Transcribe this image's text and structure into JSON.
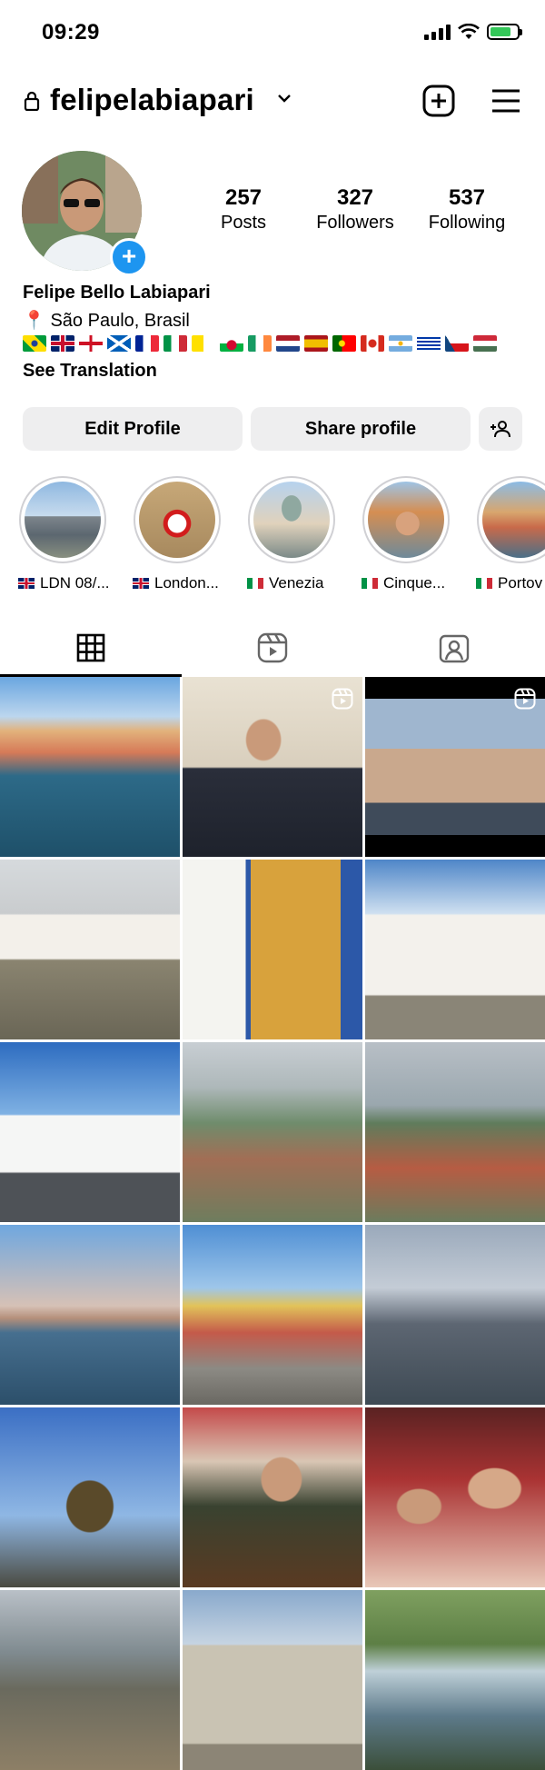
{
  "status_bar": {
    "time": "09:29",
    "battery_level": 0.8,
    "battery_color": "#34c759"
  },
  "header": {
    "username": "felipelabiapari",
    "icons": [
      "lock-icon",
      "chevron-down-icon",
      "new-post-icon",
      "menu-icon"
    ]
  },
  "profile": {
    "stats": [
      {
        "value": "257",
        "label": "Posts"
      },
      {
        "value": "327",
        "label": "Followers"
      },
      {
        "value": "537",
        "label": "Following"
      }
    ],
    "full_name": "Felipe Bello Labiapari",
    "location": "📍 São Paulo, Brasil",
    "flags": [
      "Brazil",
      "United Kingdom",
      "England",
      "Scotland",
      "France",
      "Italy",
      "Vatican City",
      "Wales",
      "Ireland",
      "Netherlands",
      "Spain",
      "Portugal",
      "Canada",
      "Argentina",
      "Uruguay",
      "Czech Republic",
      "Hungary"
    ],
    "see_translation": "See Translation",
    "accent_color": "#1d95f0"
  },
  "actions": {
    "edit_profile": "Edit Profile",
    "share_profile": "Share profile"
  },
  "highlights": [
    {
      "label": "LDN 08/...",
      "flag": "United Kingdom"
    },
    {
      "label": "London...",
      "flag": "United Kingdom"
    },
    {
      "label": "Venezia",
      "flag": "Italy"
    },
    {
      "label": "Cinque...",
      "flag": "Italy"
    },
    {
      "label": "Portov",
      "flag": "Italy"
    }
  ],
  "tabs": [
    {
      "name": "grid-icon",
      "active": true
    },
    {
      "name": "reels-icon",
      "active": false
    },
    {
      "name": "tagged-icon",
      "active": false
    }
  ],
  "posts": [
    {
      "subject": "harbor with colorful houses",
      "reel": false
    },
    {
      "subject": "man playing electric guitar",
      "reel": true
    },
    {
      "subject": "man playing guitar",
      "reel": true
    },
    {
      "subject": "cobblestone colonial street",
      "reel": false
    },
    {
      "subject": "man sitting on steps",
      "reel": false
    },
    {
      "subject": "colonial building with lamp",
      "reel": false
    },
    {
      "subject": "baroque church",
      "reel": false
    },
    {
      "subject": "hillside town view",
      "reel": false
    },
    {
      "subject": "red rooftops town view",
      "reel": false
    },
    {
      "subject": "river at sunset",
      "reel": false
    },
    {
      "subject": "colorful street with cars",
      "reel": false
    },
    {
      "subject": "river with bridge and towers",
      "reel": false
    },
    {
      "subject": "gothic memorial",
      "reel": false
    },
    {
      "subject": "man with beer",
      "reel": false
    },
    {
      "subject": "two men at pub",
      "reel": false
    },
    {
      "subject": "river bank with bridge",
      "reel": false
    },
    {
      "subject": "domed cathedral",
      "reel": false
    },
    {
      "subject": "canal with boats",
      "reel": false
    }
  ]
}
